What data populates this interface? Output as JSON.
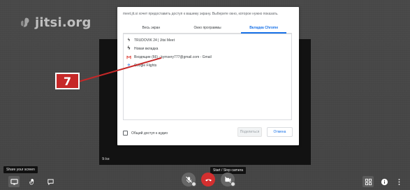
{
  "app": {
    "logo_text": "jitsi.org"
  },
  "share_dialog": {
    "title": "meet.jit.si хочет предоставить доступ к вашему экрану. Выберите окно, которое нужно показать.",
    "tabs": [
      {
        "label": "Весь экран",
        "selected": false
      },
      {
        "label": "Окно программы",
        "selected": false
      },
      {
        "label": "Вкладка Chrome",
        "selected": true
      }
    ],
    "items": [
      {
        "label": "TRUDOVIK 24 | Jitsi Meet",
        "icon": "jitsi-icon"
      },
      {
        "label": "Новая вкладка",
        "icon": "new-tab-icon"
      },
      {
        "label": "Входящие (66) - kymsery777@gmail.com - Gmail",
        "icon": "gmail-icon"
      },
      {
        "label": "Google Flights",
        "icon": "flight-icon"
      }
    ],
    "audio_checkbox_label": "Общий доступ к аудио",
    "share_button_label": "Поделиться",
    "cancel_button_label": "Отмена"
  },
  "annotation": {
    "number": "7",
    "color": "#c62828"
  },
  "video": {
    "participant_label": "9:ke"
  },
  "tooltips": {
    "share_screen": "Share your screen",
    "camera": "Start / Stop camera"
  },
  "toolbar": {
    "left_icons": [
      "monitor-icon",
      "hand-icon",
      "chat-icon"
    ],
    "center_icons": [
      "microphone-icon",
      "hangup-icon",
      "camera-icon"
    ],
    "right_icons": [
      "grid-icon",
      "info-icon",
      "more-vertical-icon"
    ]
  },
  "colors": {
    "page_bg": "#414141",
    "accent": "#1a73e8",
    "hangup": "#d32f2f"
  }
}
